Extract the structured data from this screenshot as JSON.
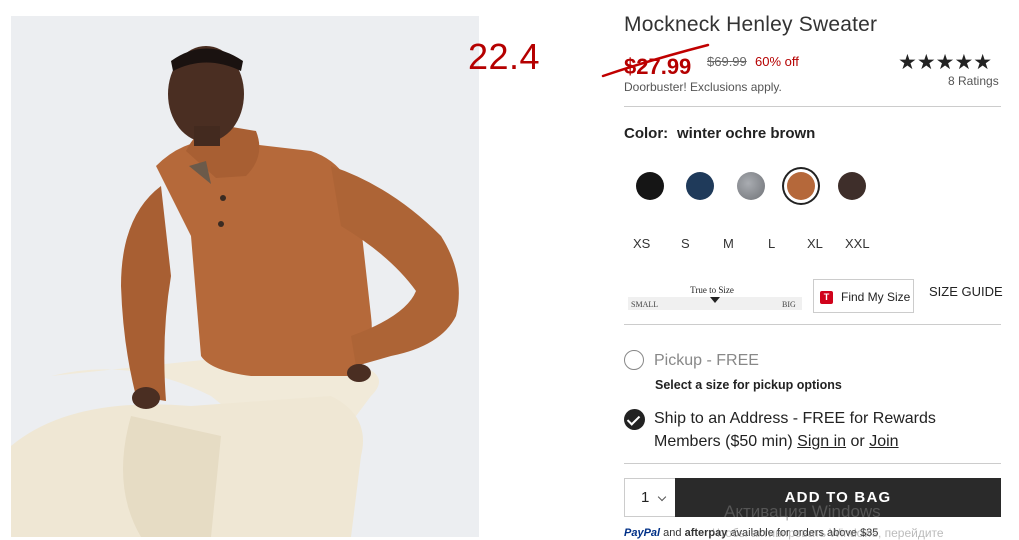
{
  "overlay_note": "22.4",
  "product": {
    "title": "Mockneck Henley Sweater",
    "sale_price": "$27.99",
    "original_price": "$69.99",
    "discount": "60% off",
    "promo_note": "Doorbuster! Exclusions apply.",
    "stars": "★★★★★",
    "ratings": "8 Ratings"
  },
  "color": {
    "label": "Color:",
    "value": "winter ochre brown",
    "swatches": [
      {
        "name": "black",
        "hex": "#151515"
      },
      {
        "name": "navy",
        "hex": "#1f3a5a"
      },
      {
        "name": "grey heather",
        "hex": "#8c8f95"
      },
      {
        "name": "winter ochre brown",
        "hex": "#b5683a",
        "selected": true
      },
      {
        "name": "dark brown heather",
        "hex": "#3e2e2a"
      }
    ]
  },
  "sizes": [
    "XS",
    "S",
    "M",
    "L",
    "XL",
    "XXL"
  ],
  "fit": {
    "label": "True to Size",
    "small": "SMALL",
    "big": "BIG",
    "position": 0.5
  },
  "find_my_size": {
    "logo": "T",
    "label": "Find My Size"
  },
  "size_guide": "SIZE GUIDE",
  "fulfillment": {
    "pickup_label": "Pickup - FREE",
    "pickup_note": "Select a size for pickup options",
    "ship_line1": "Ship to an Address - FREE for Rewards",
    "ship_line2_pre": "Members ($50 min)",
    "sign_in": "Sign in",
    "or": "or",
    "join": "Join"
  },
  "quantity": "1",
  "add_to_bag": "ADD TO BAG",
  "payments": {
    "paypal": "PayPal",
    "and": "and",
    "afterpay": "afterpay",
    "note": "available for orders above $35"
  },
  "watermark": {
    "title": "Активация Windows",
    "sub": "Чтобы активировать Windows, перейдите"
  },
  "colors": {
    "sale": "#b50000",
    "dark": "#2a2a2a"
  }
}
